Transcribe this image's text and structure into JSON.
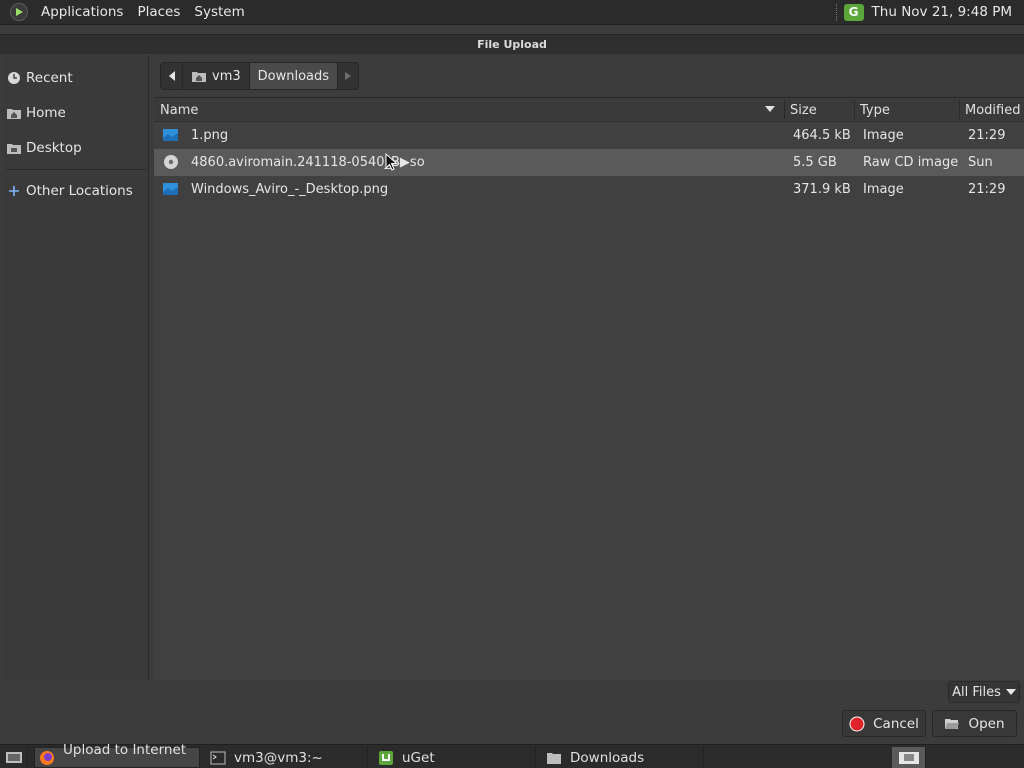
{
  "top_panel": {
    "menus": [
      "Applications",
      "Places",
      "System"
    ],
    "tray_icon_label": "G",
    "clock": "Thu Nov 21,  9:48 PM"
  },
  "dialog": {
    "title": "File Upload"
  },
  "sidebar": {
    "items": [
      {
        "label": "Recent",
        "icon": "clock-icon"
      },
      {
        "label": "Home",
        "icon": "home-folder-icon"
      },
      {
        "label": "Desktop",
        "icon": "desktop-folder-icon"
      },
      {
        "label": "Other Locations",
        "icon": "plus-icon"
      }
    ]
  },
  "pathbar": {
    "segments": [
      "vm3",
      "Downloads"
    ],
    "active": "Downloads"
  },
  "file_list": {
    "columns": [
      "Name",
      "Size",
      "Type",
      "Modified"
    ],
    "rows": [
      {
        "name": "1.png",
        "size": "464.5 kB",
        "type": "Image",
        "modified": "21:29",
        "icon": "image-file-icon"
      },
      {
        "name": "4860.aviromain.241118-0540_B▶so",
        "size": "5.5 GB",
        "type": "Raw CD image",
        "modified": "Sun",
        "icon": "disc-image-icon",
        "selected": true
      },
      {
        "name": "Windows_Aviro_-_Desktop.png",
        "size": "371.9 kB",
        "type": "Image",
        "modified": "21:29",
        "icon": "image-file-icon"
      }
    ]
  },
  "footer": {
    "filter": "All Files",
    "cancel": "Cancel",
    "open": "Open"
  },
  "taskbar": {
    "items": [
      {
        "label": "Upload to Internet ...",
        "icon": "firefox-icon",
        "active": true
      },
      {
        "label": "vm3@vm3:~",
        "icon": "terminal-icon"
      },
      {
        "label": "uGet",
        "icon": "uget-icon"
      },
      {
        "label": "Downloads",
        "icon": "folder-icon"
      }
    ]
  },
  "colors": {
    "panel": "#2b2b2b",
    "dialog_bg": "#3c3c3c",
    "list_bg": "#404040",
    "selected_row": "#5a5a5a",
    "image_icon": "#2f8fd8",
    "uget_green": "#5aa63a",
    "cancel_red": "#e0222a"
  }
}
